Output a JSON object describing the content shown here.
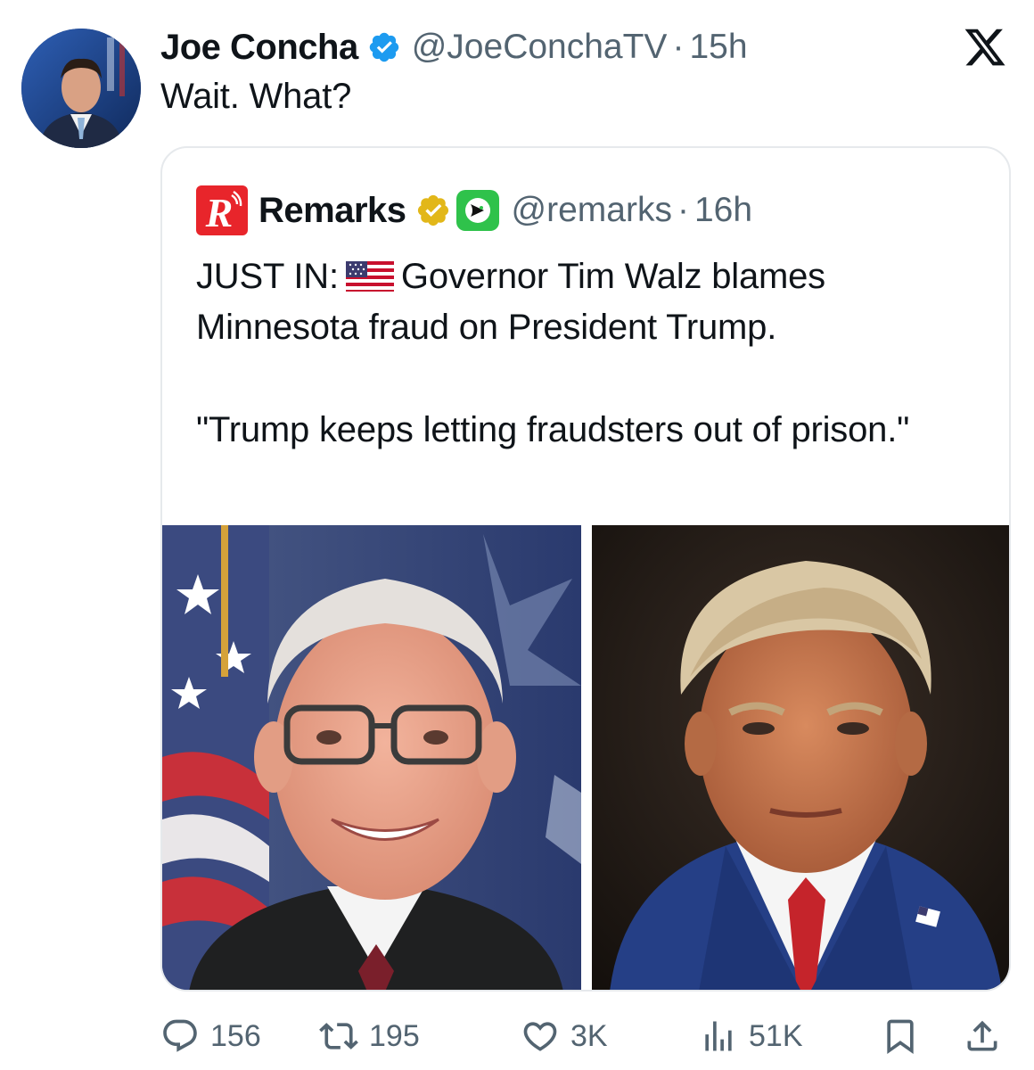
{
  "tweet": {
    "author": {
      "display_name": "Joe Concha",
      "handle": "@JoeConchaTV",
      "verified": true,
      "avatar_icon": "user-avatar"
    },
    "separator": "·",
    "time": "15h",
    "text": "Wait. What?",
    "platform_icon": "x-logo-icon"
  },
  "quoted_tweet": {
    "author": {
      "display_name": "Remarks",
      "handle": "@remarks",
      "badge": "gold-verified",
      "logo_letter": "R"
    },
    "separator": "·",
    "time": "16h",
    "text_prefix": "JUST IN:",
    "text_rest": "Governor Tim Walz blames Minnesota fraud on President Trump.",
    "quote": "\"Trump keeps letting fraudsters out of prison.\"",
    "images": [
      "photo-tim-walz",
      "photo-donald-trump"
    ]
  },
  "actions": {
    "replies": "156",
    "reposts": "195",
    "likes": "3K",
    "views": "51K"
  },
  "colors": {
    "text": "#0f1419",
    "secondary": "#536471",
    "verified_blue": "#1d9bf0",
    "gold_badge": "#e2b719",
    "remarks_red": "#e8252b",
    "border": "#e6e9ec"
  }
}
